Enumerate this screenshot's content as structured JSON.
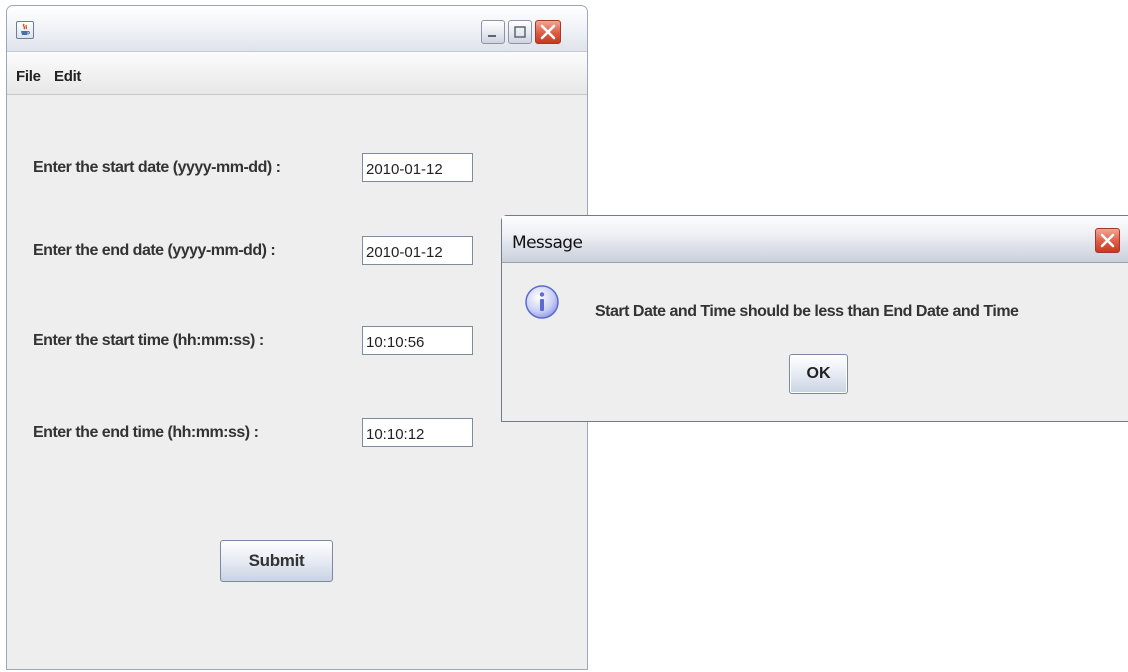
{
  "main_window": {
    "title": "",
    "icon": "java-cup-icon",
    "controls": [
      "minimize-icon",
      "maximize-icon",
      "close-icon"
    ],
    "menu": {
      "items": [
        "File",
        "Edit"
      ]
    },
    "form": {
      "start_date_label": "Enter the start date (yyyy-mm-dd) :",
      "start_date_value": "2010-01-12",
      "end_date_label": "Enter the end date (yyyy-mm-dd) :",
      "end_date_value": "2010-01-12",
      "start_time_label": "Enter the start time (hh:mm:ss) :",
      "start_time_value": "10:10:56",
      "end_time_label": "Enter the end time (hh:mm:ss) :",
      "end_time_value": "10:10:12",
      "submit_label": "Submit"
    }
  },
  "dialog": {
    "title": "Message",
    "icon": "info-icon",
    "message": "Start Date and Time should be less than End Date and Time",
    "ok_label": "OK"
  },
  "colors": {
    "window_bg": "#eeeeee",
    "close_button": "#de5b43",
    "info_icon": "#5b6bd0"
  }
}
